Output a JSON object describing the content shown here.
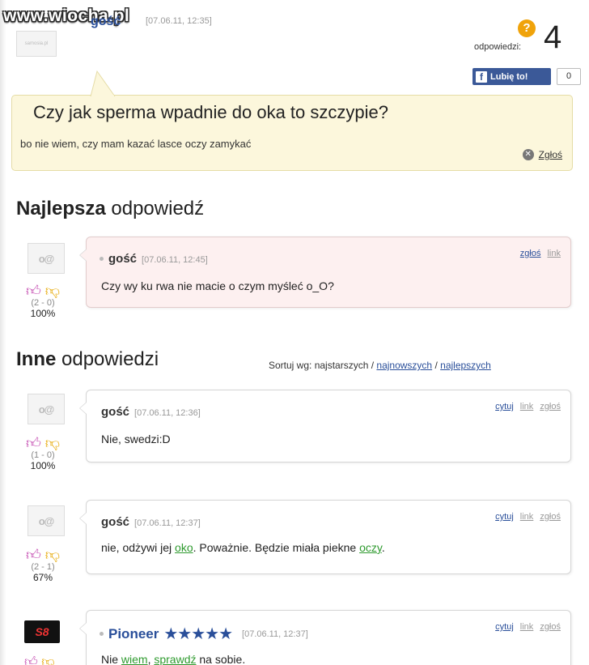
{
  "site": {
    "watermark": "www.wiocha.pl"
  },
  "question": {
    "author": "gość",
    "date": "[07.06.11, 12:35]",
    "avatar_brand": "samosia.pl",
    "answers_label": "odpowiedzi:",
    "answers_count": "4",
    "like_label": "Lubię to!",
    "like_count": "0",
    "title": "Czy jak sperma wpadnie do oka to szczypie?",
    "body": "bo nie wiem, czy mam kazać lasce oczy zamykać",
    "report_label": "Zgłoś"
  },
  "best": {
    "heading_bold": "Najlepsza",
    "heading_rest": "odpowiedź",
    "answer": {
      "author": "gość",
      "date": "[07.06.11, 12:45]",
      "actions": [
        "zgłoś",
        "link"
      ],
      "text": "Czy wy ku rwa nie macie o czym myśleć o_O?",
      "votes": "(2 - 0)",
      "percent": "100%"
    }
  },
  "others": {
    "heading_bold": "Inne",
    "heading_rest": "odpowiedzi",
    "sort_label": "Sortuj wg: najstarszych /",
    "sort_newest": "najnowszych",
    "sort_sep": "/",
    "sort_best": "najlepszych",
    "answers": [
      {
        "author": "gość",
        "date": "[07.06.11, 12:36]",
        "actions": [
          "cytuj",
          "link",
          "zgłoś"
        ],
        "text": "Nie, swedzi:D",
        "votes": "(1 - 0)",
        "percent": "100%"
      },
      {
        "author": "gość",
        "date": "[07.06.11, 12:37]",
        "actions": [
          "cytuj",
          "link",
          "zgłoś"
        ],
        "text_parts": [
          "nie, odżywi jej ",
          "oko",
          ". Poważnie. Będzie miała piekne ",
          "oczy",
          "."
        ],
        "votes": "(2 - 1)",
        "percent": "67%"
      },
      {
        "author": "Pioneer",
        "stars": "★★★★★",
        "date": "[07.06.11, 12:37]",
        "actions": [
          "cytuj",
          "link",
          "zgłoś"
        ],
        "text_parts": [
          "Nie ",
          "wiem",
          ", ",
          "sprawdź",
          " na sobie."
        ]
      }
    ]
  }
}
